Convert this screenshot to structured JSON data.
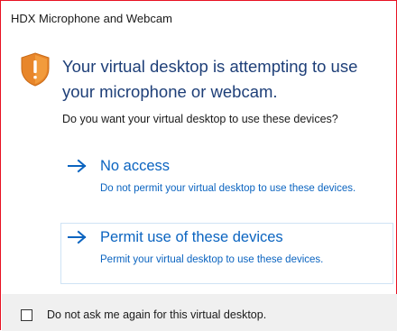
{
  "window": {
    "title": "HDX Microphone and Webcam"
  },
  "header": {
    "icon": "shield-warning-icon",
    "headline": "Your virtual desktop is attempting to use your microphone or webcam."
  },
  "prompt": {
    "question": "Do you want your virtual desktop to use these devices?"
  },
  "options": [
    {
      "icon": "arrow-right-icon",
      "title": "No access",
      "description": "Do not permit your virtual desktop to use these devices."
    },
    {
      "icon": "arrow-right-icon",
      "title": "Permit use of these devices",
      "description": "Permit your virtual desktop to use these devices."
    }
  ],
  "footer": {
    "checkbox_label": "Do not ask me again for this virtual desktop.",
    "checked": false
  },
  "colors": {
    "accent": "#0b64c0",
    "headline": "#1e3f78",
    "window_border": "#e81123",
    "shield": "#e8862a",
    "footer_bg": "#f0f0f0"
  }
}
